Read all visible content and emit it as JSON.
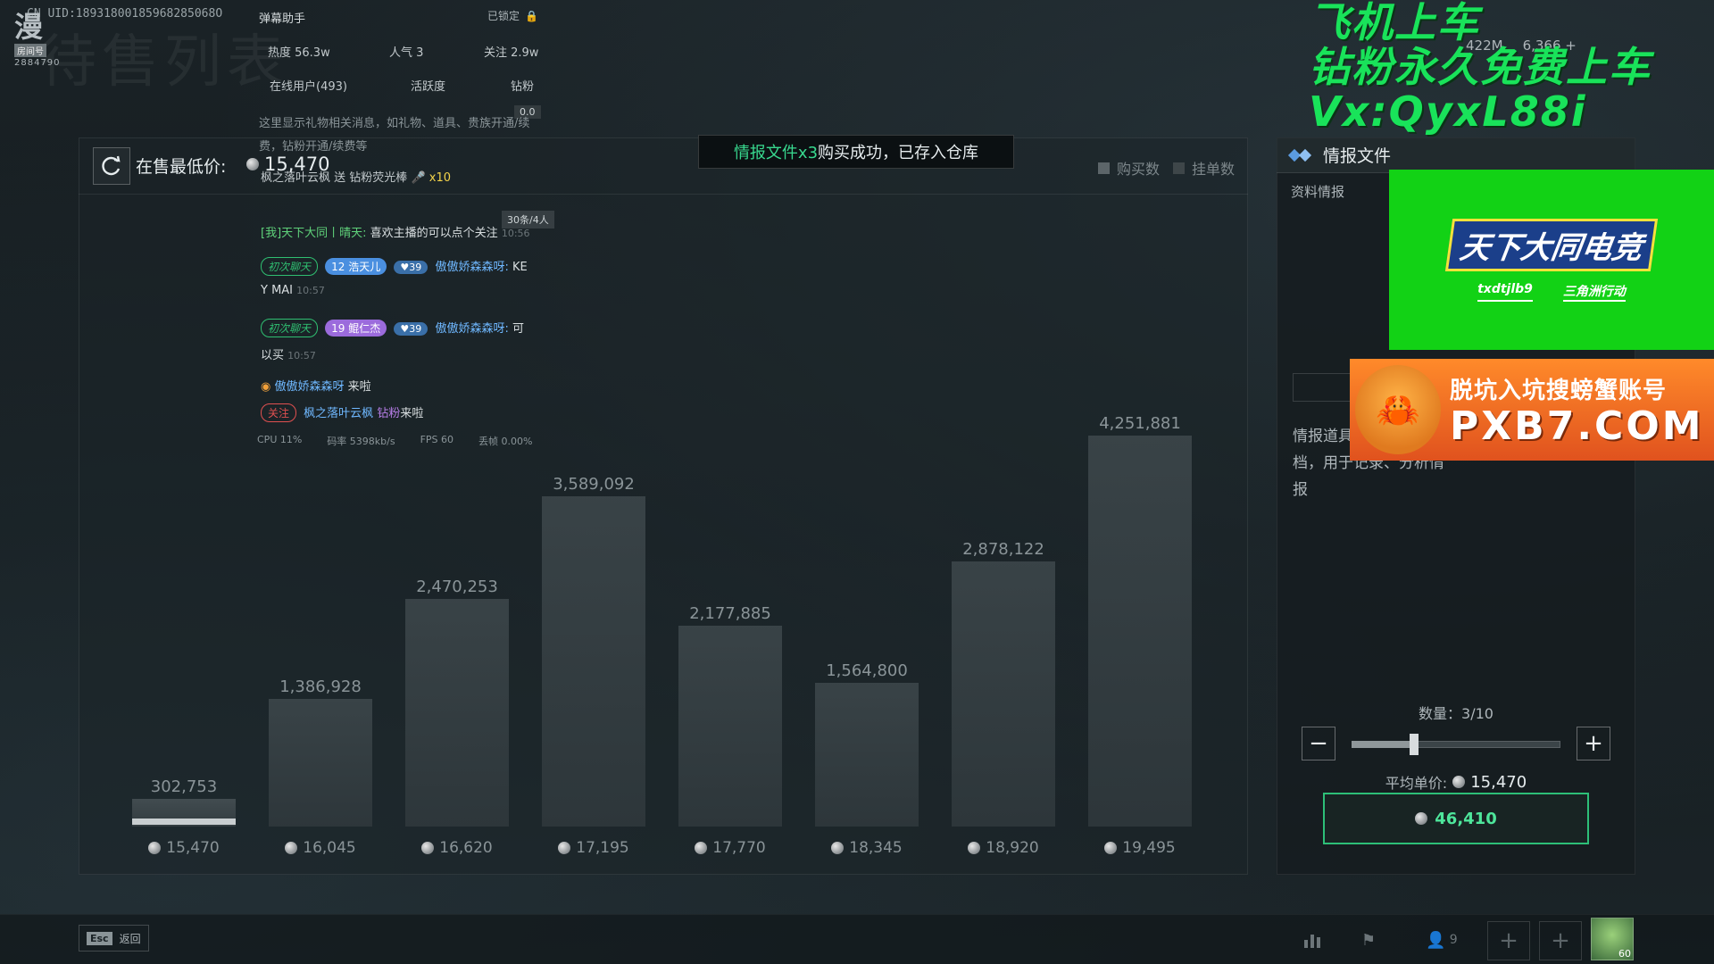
{
  "background_title": "待售列表",
  "uid": "CN UID:18931800185968285068O",
  "logo": {
    "big": "漫",
    "tag": "房间号",
    "num": "2884790"
  },
  "market": {
    "lowest_label": "在售最低价:",
    "lowest_value": "15,470",
    "legend_buy": "购买数",
    "legend_list": "挂单数"
  },
  "toast": {
    "highlight": "情报文件x3",
    "text": "购买成功，已存入仓库"
  },
  "chart_data": {
    "type": "bar",
    "categories": [
      "15,470",
      "16,045",
      "16,620",
      "17,195",
      "17,770",
      "18,345",
      "18,920",
      "19,495"
    ],
    "values": [
      302753,
      1386928,
      2470253,
      3589092,
      2177885,
      1564800,
      2878122,
      4251881
    ],
    "value_labels": [
      "302,753",
      "1,386,928",
      "2,470,253",
      "3,589,092",
      "2,177,885",
      "1,564,800",
      "2,878,122",
      "4,251,881"
    ],
    "selected_index": 0,
    "title": "",
    "xlabel": "",
    "ylabel": "",
    "ylim": [
      0,
      4500000
    ]
  },
  "right_panel": {
    "title": "情报文件",
    "subtitle": "资料情报",
    "desc_line1": "情报道具",
    "desc_line2": "档，用于记录、分析情报",
    "qty_label": "数量：3/10",
    "qty_fraction": 0.3,
    "minus": "−",
    "plus": "+",
    "avg_label": "平均单价:",
    "avg_value": "15,470",
    "total": "46,410"
  },
  "chat": {
    "title": "弹幕助手",
    "locked": "已锁定",
    "heat": "热度 56.3w",
    "popularity": "人气 3",
    "follow": "关注 2.9w",
    "online": "在线用户(493)",
    "activity": "活跃度",
    "fans": "钻粉",
    "coin_badge": "0.0",
    "notice": "这里显示礼物相关消息，如礼物、道具、贵族开通/续费，钻粉开通/续费等",
    "gift_user": "枫之落叶云枫",
    "gift_text": "送 钻粉荧光棒",
    "gift_count": "x10",
    "msg_count": "30条/4人",
    "line1_name": "[我]天下大同丨晴天:",
    "line1_text": "喜欢主播的可以点个关注",
    "line1_time": "10:56",
    "line2_tag": "初次聊天",
    "line2_lv": "12",
    "line2_badge": "浩天儿",
    "line2_fan": "39",
    "line2_name": "傲傲娇森森呀:",
    "line2_text": "KE",
    "line2_text2": "Y MAI",
    "line2_time": "10:57",
    "line3_tag": "初次聊天",
    "line3_lv": "19",
    "line3_badge": "鲲仁杰",
    "line3_fan": "39",
    "line3_name": "傲傲娇森森呀:",
    "line3_text": "可",
    "line3_text2": "以买",
    "line3_time": "10:57",
    "line4_name": "傲傲娇森森呀",
    "line4_text": "来啦",
    "line5_tag": "关注",
    "line5_name": "枫之落叶云枫",
    "line5_fans": "钻粉",
    "line5_text": "来啦",
    "cpu": "CPU 11%",
    "bitrate": "码率 5398kb/s",
    "fps": "FPS 60",
    "drop": "丢帧 0.00%"
  },
  "promo": {
    "line1": "飞机上车",
    "line2": "钻粉永久免费上车",
    "line3": "Vx:QyxL88i"
  },
  "mini_stats": {
    "a": "422M",
    "b": "6,366 +"
  },
  "green_box": {
    "title": "天下大同电竞",
    "left": "txdtjlb9",
    "right": "三角洲行动"
  },
  "ad": {
    "line1": "脱坑入坑搜螃蟹账号",
    "line2": "PXB7.COM"
  },
  "bottom": {
    "esc_key": "Esc",
    "esc_label": "返回",
    "people_count": "9",
    "avatar_lv": "60"
  }
}
